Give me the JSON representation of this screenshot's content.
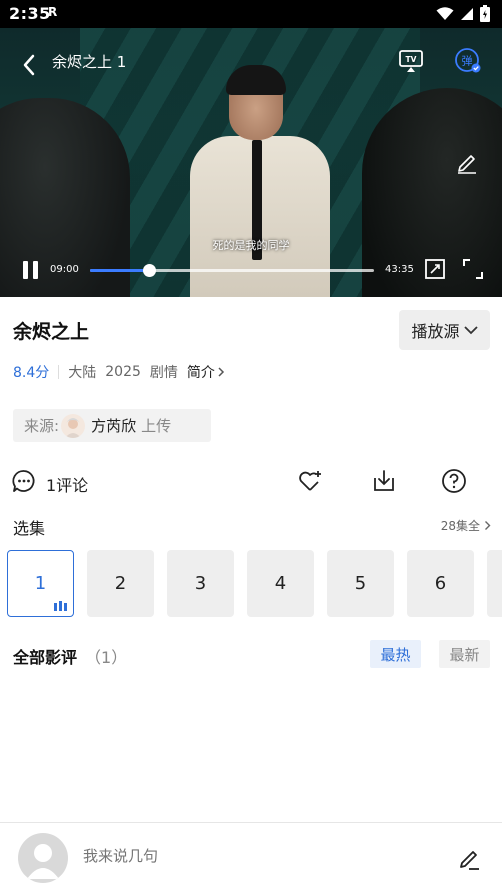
{
  "status_bar": {
    "time": "2:35",
    "r_icon": "R"
  },
  "player": {
    "title": "余烬之上 1",
    "subtitle": "死的是我的同学",
    "current_time": "09:00",
    "total_time": "43:35",
    "progress": 0.2065,
    "tv_label": "TV",
    "danmu_label": "弹"
  },
  "show": {
    "title": "余烬之上",
    "source_button": "播放源",
    "rating": "8.4分",
    "region": "大陆",
    "year": "2025",
    "genre": "剧情",
    "intro_label": "简介"
  },
  "uploader": {
    "label": "来源:",
    "name": "方芮欣",
    "action": "上传"
  },
  "actions": {
    "comment_count": "1评论"
  },
  "episodes": {
    "header": "选集",
    "all_label": "28集全",
    "items": [
      "1",
      "2",
      "3",
      "4",
      "5",
      "6"
    ],
    "active_index": 0
  },
  "reviews": {
    "title": "全部影评",
    "count": "（1）",
    "sort_hot": "最热",
    "sort_new": "最新"
  },
  "comment_box": {
    "placeholder": "我来说几句"
  },
  "colors": {
    "accent": "#2e6fd8"
  }
}
